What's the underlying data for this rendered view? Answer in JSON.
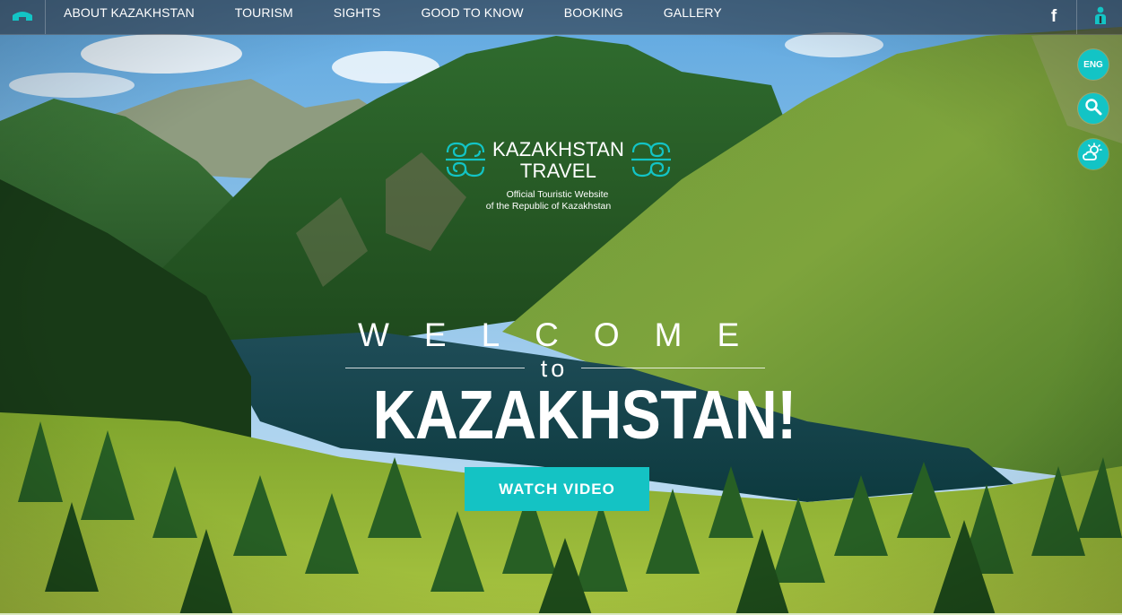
{
  "nav": {
    "home_icon": "home-icon",
    "items": [
      {
        "label": "ABOUT KAZAKHSTAN"
      },
      {
        "label": "TOURISM"
      },
      {
        "label": "SIGHTS"
      },
      {
        "label": "GOOD TO KNOW"
      },
      {
        "label": "BOOKING"
      },
      {
        "label": "GALLERY"
      }
    ],
    "facebook_label": "f",
    "user_icon": "user-icon"
  },
  "side_buttons": {
    "language": "ENG",
    "search_icon": "search-icon",
    "weather_icon": "weather-icon"
  },
  "logo": {
    "title_line1": "KAZAKHSTAN",
    "title_line2": "TRAVEL",
    "subtitle_line1": "Official Touristic Website",
    "subtitle_line2": "of the Republic of Kazakhstan"
  },
  "hero": {
    "welcome": "WELCOME",
    "to": "to",
    "country": "KAZAKHSTAN!",
    "watch_button": "WATCH VIDEO"
  },
  "colors": {
    "accent": "#13c4c5",
    "nav_bg": "#28283080"
  }
}
